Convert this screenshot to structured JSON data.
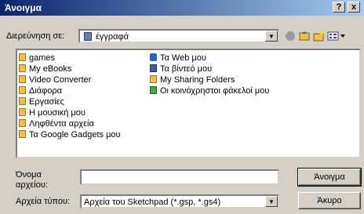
{
  "window": {
    "title": "Άνοιγμα",
    "help": "?",
    "close": "x"
  },
  "lookin": {
    "label": "Διερεύνηση σε:",
    "value": "έγγραφά"
  },
  "files": {
    "col1": [
      "games",
      "My eBooks",
      "Video Converter",
      "Διάφορα",
      "Εργασίες",
      "Η μουσική μου",
      "Ληφθέντα αρχεία",
      "Τα Google Gadgets μου"
    ],
    "col2": [
      "Τα Web μου",
      "Τα βίντεό μου",
      "My Sharing Folders",
      "Οι κοινόχρηστοι φάκελοί μου"
    ]
  },
  "filename": {
    "label_line1": "Όνομα",
    "label_line2": "αρχείου:",
    "value": ""
  },
  "filetype": {
    "label": "Αρχεία τύπου:",
    "value": "Αρχεία του Sketchpad (*.gsp, *.gs4)"
  },
  "buttons": {
    "open": "Άνοιγμα",
    "cancel": "Άκυρο"
  },
  "icons": {
    "folder": "folder-icon",
    "web": "globe-icon",
    "video": "film-icon"
  }
}
